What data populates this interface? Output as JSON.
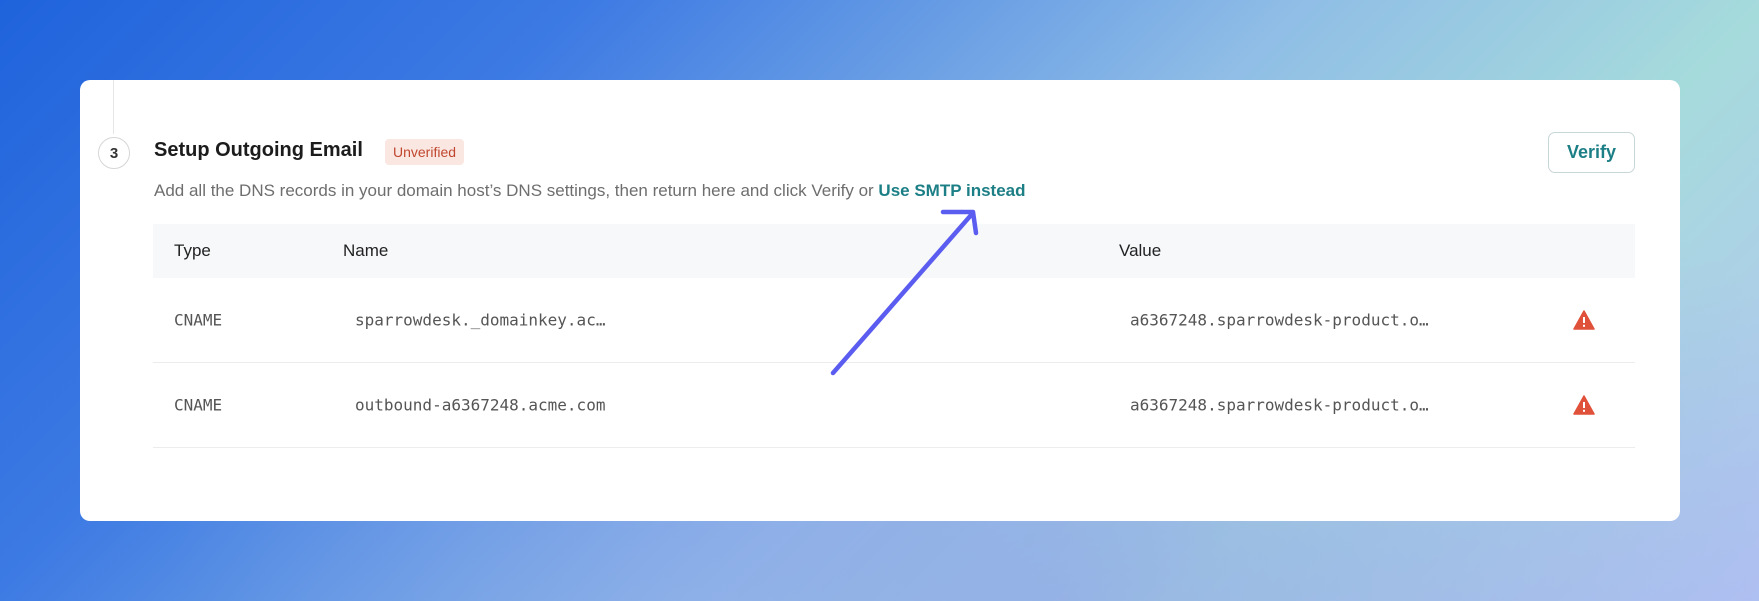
{
  "step": {
    "number": "3"
  },
  "section": {
    "title": "Setup Outgoing Email",
    "status_badge": "Unverified",
    "description": "Add all the DNS records in your domain host’s DNS settings, then return here and click Verify or ",
    "link_label": "Use SMTP instead",
    "verify_label": "Verify"
  },
  "table": {
    "headers": {
      "type": "Type",
      "name": "Name",
      "value": "Value"
    },
    "rows": [
      {
        "type": "CNAME",
        "name": "sparrowdesk._domainkey.ac…",
        "value": "a6367248.sparrowdesk-product.o…",
        "status_icon": "warning-icon"
      },
      {
        "type": "CNAME",
        "name": "outbound-a6367248.acme.com",
        "value": "a6367248.sparrowdesk-product.o…",
        "status_icon": "warning-icon"
      }
    ]
  },
  "colors": {
    "accent": "#1d7f86",
    "badge_bg": "#fbe7e2",
    "badge_text": "#c0472f",
    "warning": "#e0513a",
    "annotation_arrow": "#5b5cf0"
  }
}
